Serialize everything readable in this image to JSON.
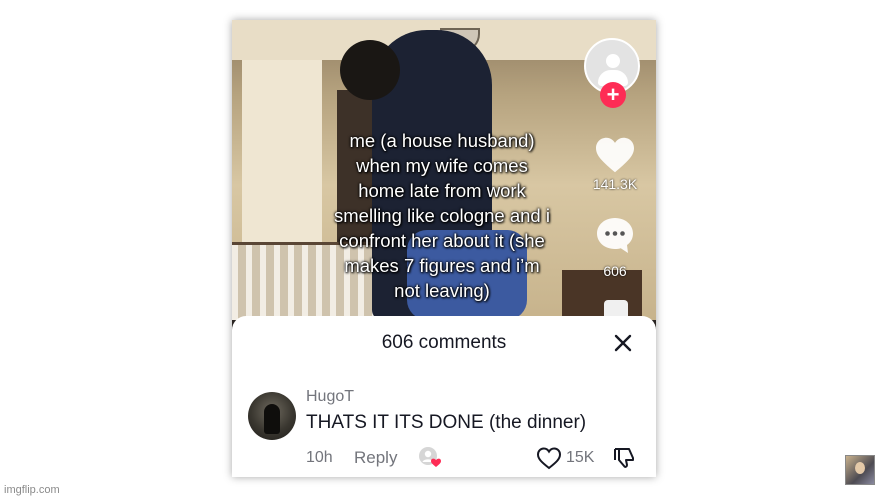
{
  "video": {
    "overlay_text": "me (a house husband)\nwhen my wife comes\nhome late from work\nsmelling like cologne and i\nconfront her about it (she\nmakes 7 figures and i’m\nnot leaving)",
    "like_count": "141.3K",
    "comment_count": "606",
    "follow_icon": "+"
  },
  "comments_panel": {
    "title": "606 comments",
    "comment": {
      "username": "HugoT",
      "text": "THATS IT ITS DONE (the dinner)",
      "time": "10h",
      "reply_label": "Reply",
      "like_count": "15K"
    }
  },
  "watermark": "imgflip.com",
  "colors": {
    "follow": "#fe2c55",
    "creator_heart": "#fe2c55",
    "sheet_bg": "#ffffff",
    "muted_text": "#73757c"
  },
  "icons": [
    "plus-icon",
    "heart-icon",
    "comment-icon",
    "close-icon",
    "like-icon",
    "dislike-icon",
    "creator-liked-icon"
  ]
}
